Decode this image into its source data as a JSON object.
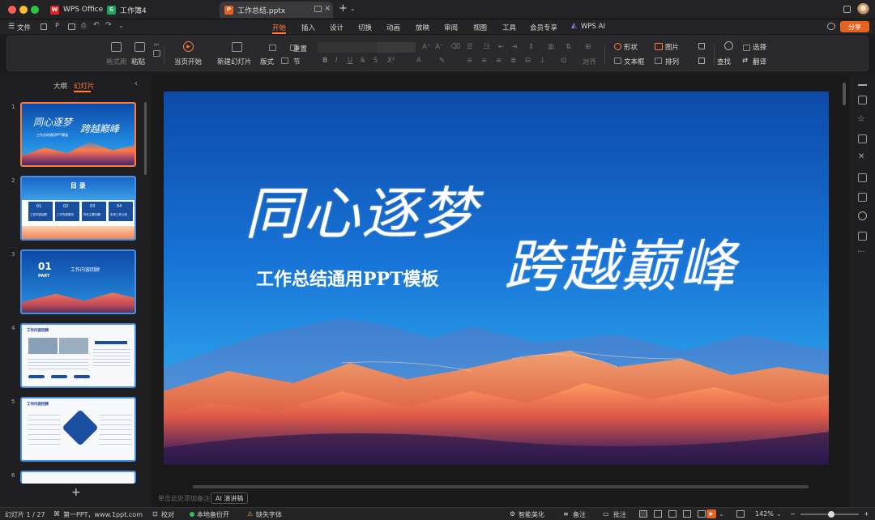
{
  "titlebar": {
    "tabs": [
      {
        "label": "WPS Office"
      },
      {
        "label": "工作簿4"
      },
      {
        "label": "工作总结.pptx"
      }
    ]
  },
  "menubar": {
    "file": "文件",
    "items": [
      "开始",
      "插入",
      "设计",
      "切换",
      "动画",
      "放映",
      "审阅",
      "视图",
      "工具",
      "会员专享",
      "WPS AI"
    ],
    "share": "分享"
  },
  "ribbon": {
    "format_painter": "格式刷",
    "paste": "粘贴",
    "play_from_current": "当页开始",
    "new_slide": "新建幻灯片",
    "layout": "版式",
    "reset": "重置",
    "section": "节",
    "align": "对齐",
    "shape": "形状",
    "picture": "图片",
    "textbox": "文本框",
    "arrange": "排列",
    "find": "查找",
    "select": "选择",
    "translate": "翻译"
  },
  "sidebar": {
    "tab_outline": "大纲",
    "tab_slides": "幻灯片",
    "thumbs": [
      {
        "num": "1",
        "title_a": "同心逐梦",
        "title_b": "跨越巅峰",
        "subtitle": "工作总结通用PPT模板"
      },
      {
        "num": "2",
        "title": "目 录",
        "items": [
          "工作内容回顾",
          "工作完成情况",
          "存在主要问题",
          "未来工作计划"
        ],
        "nums": [
          "01",
          "02",
          "03",
          "04"
        ]
      },
      {
        "num": "3",
        "part_num": "01",
        "part_label": "PART",
        "title": "工作内容回顾"
      },
      {
        "num": "4",
        "title": "工作内容回顾"
      },
      {
        "num": "5",
        "title": "工作内容回顾"
      },
      {
        "num": "6"
      }
    ]
  },
  "slide": {
    "title_a": "同心逐梦",
    "title_b": "跨越巅峰",
    "subtitle": "工作总结通用PPT模板"
  },
  "notes": {
    "placeholder": "单击此处添加备注",
    "ai_button": "AI 演讲稿"
  },
  "status": {
    "slide_counter": "幻灯片 1 / 27",
    "template": "第一PPT，www.1ppt.com",
    "proofread": "校对",
    "backup": "本地备份开",
    "missing_font": "缺失字体",
    "beautify": "智能美化",
    "notes": "备注",
    "comments": "批注",
    "zoom": "142%"
  },
  "colors": {
    "accent": "#ff7d3c",
    "share_bg": "#e8621f",
    "thumb_selected_border": "#ff7d3c",
    "thumb_border": "#4a90e2"
  }
}
